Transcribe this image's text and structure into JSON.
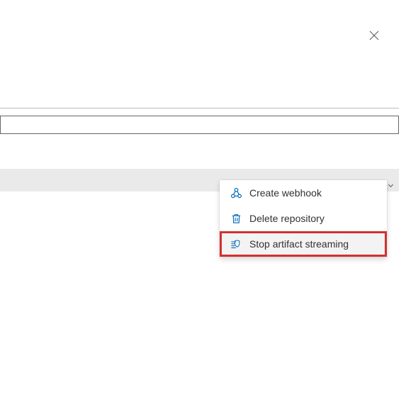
{
  "close_aria": "Close",
  "menu": {
    "items": [
      {
        "label": "Create webhook",
        "icon": "webhook-icon"
      },
      {
        "label": "Delete repository",
        "icon": "trash-icon"
      },
      {
        "label": "Stop artifact streaming",
        "icon": "stream-shield-icon",
        "highlighted": true
      }
    ]
  },
  "colors": {
    "accent": "#0067b8",
    "highlight_border": "#d13131"
  }
}
